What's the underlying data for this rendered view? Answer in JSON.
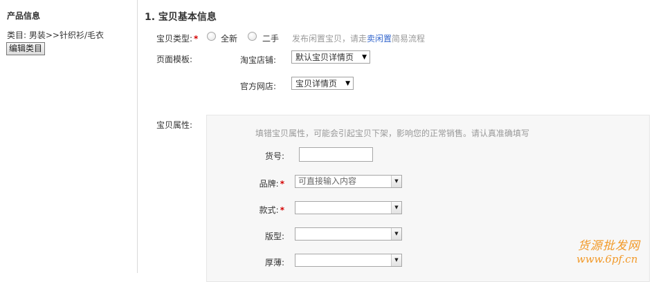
{
  "sidebar": {
    "title": "产品信息",
    "category": "类目: 男装>>针织衫/毛衣",
    "edit_button": "编辑类目"
  },
  "section": {
    "title": "1. 宝贝基本信息"
  },
  "item_type": {
    "label": "宝贝类型:",
    "required": "*",
    "options": [
      "全新",
      "二手"
    ],
    "selected": null,
    "hint_prefix": "发布闲置宝贝，请走",
    "hint_link": "卖闲置",
    "hint_suffix": "简易流程"
  },
  "page_template": {
    "label": "页面模板:",
    "taobao_label": "淘宝店铺:",
    "taobao_value": "默认宝贝详情页",
    "official_label": "官方网店:",
    "official_value": "宝贝详情页"
  },
  "attributes": {
    "label": "宝贝属性:",
    "hint": "填错宝贝属性，可能会引起宝贝下架，影响您的正常销售。请认真准确填写",
    "fields": [
      {
        "label": "货号:",
        "required": false,
        "type": "text",
        "value": ""
      },
      {
        "label": "品牌:",
        "required": true,
        "type": "combo",
        "value": "可直接输入内容"
      },
      {
        "label": "款式:",
        "required": true,
        "type": "combo",
        "value": ""
      },
      {
        "label": "版型:",
        "required": false,
        "type": "combo",
        "value": ""
      },
      {
        "label": "厚薄:",
        "required": false,
        "type": "combo",
        "value": ""
      }
    ]
  },
  "watermark": {
    "line1": "货源批发网",
    "line2": "www.6pf.cn"
  },
  "colors": {
    "required": "#d40000",
    "hint": "#999999",
    "link": "#3366cc",
    "attr_bg": "#f7f7f7",
    "watermark": "#f29a2a"
  }
}
